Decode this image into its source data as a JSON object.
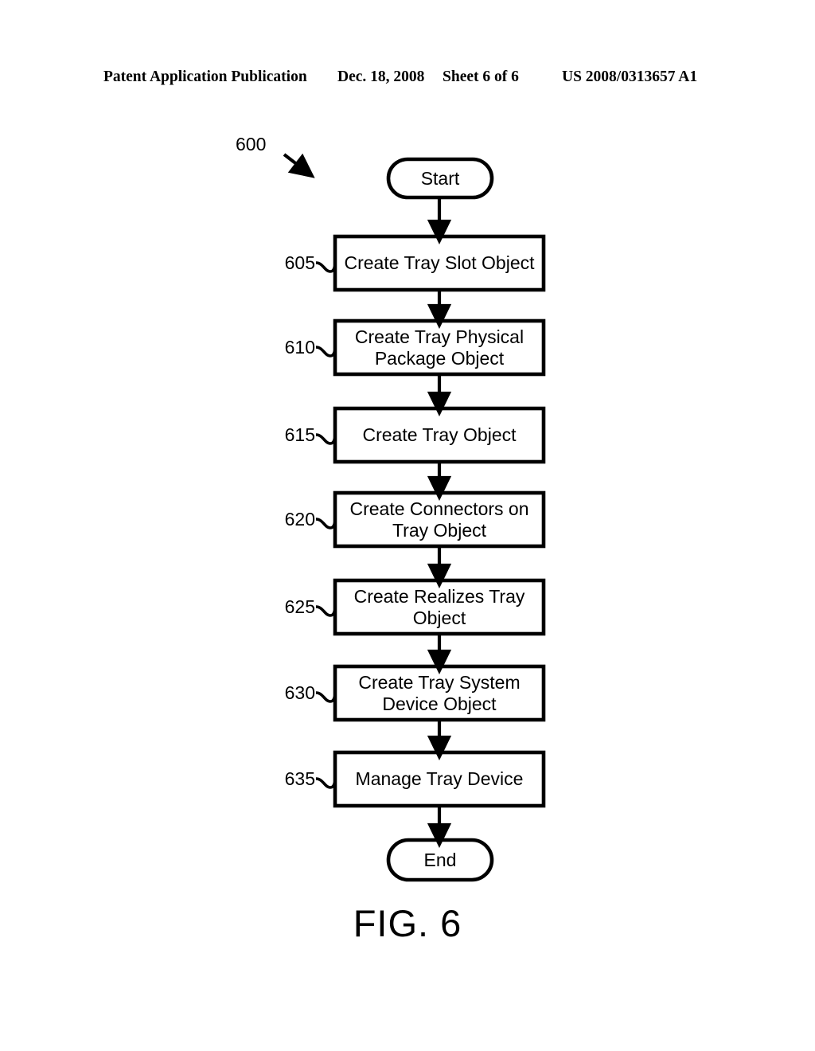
{
  "header": {
    "left": "Patent Application Publication",
    "date": "Dec. 18, 2008",
    "sheet": "Sheet 6 of 6",
    "number": "US 2008/0313657 A1"
  },
  "figure": {
    "caption": "FIG. 6",
    "diagram_reference": "600",
    "line_color": "#000000",
    "fill_color": "#ffffff",
    "background": "#ffffff",
    "type": "flowchart",
    "nodes": [
      {
        "id": "start",
        "shape": "terminal",
        "ref": "",
        "lines": [
          "Start"
        ],
        "text": "Start"
      },
      {
        "id": "step-605",
        "shape": "process",
        "ref": "605",
        "lines": [
          "Create Tray Slot Object"
        ],
        "text": "Create Tray Slot Object"
      },
      {
        "id": "step-610",
        "shape": "process",
        "ref": "610",
        "lines": [
          "Create Tray Physical",
          "Package Object"
        ],
        "text": "Create Tray Physical Package Object"
      },
      {
        "id": "step-615",
        "shape": "process",
        "ref": "615",
        "lines": [
          "Create Tray Object"
        ],
        "text": "Create Tray Object"
      },
      {
        "id": "step-620",
        "shape": "process",
        "ref": "620",
        "lines": [
          "Create Connectors on",
          "Tray Object"
        ],
        "text": "Create Connectors on Tray Object"
      },
      {
        "id": "step-625",
        "shape": "process",
        "ref": "625",
        "lines": [
          "Create Realizes Tray",
          "Object"
        ],
        "text": "Create Realizes Tray Object"
      },
      {
        "id": "step-630",
        "shape": "process",
        "ref": "630",
        "lines": [
          "Create Tray System",
          "Device Object"
        ],
        "text": "Create Tray System Device Object"
      },
      {
        "id": "step-635",
        "shape": "process",
        "ref": "635",
        "lines": [
          "Manage Tray Device"
        ],
        "text": "Manage Tray Device"
      },
      {
        "id": "end",
        "shape": "terminal",
        "ref": "",
        "lines": [
          "End"
        ],
        "text": "End"
      }
    ],
    "edges": [
      {
        "from": "start",
        "to": "step-605"
      },
      {
        "from": "step-605",
        "to": "step-610"
      },
      {
        "from": "step-610",
        "to": "step-615"
      },
      {
        "from": "step-615",
        "to": "step-620"
      },
      {
        "from": "step-620",
        "to": "step-625"
      },
      {
        "from": "step-625",
        "to": "step-630"
      },
      {
        "from": "step-630",
        "to": "step-635"
      },
      {
        "from": "step-635",
        "to": "end"
      }
    ]
  }
}
